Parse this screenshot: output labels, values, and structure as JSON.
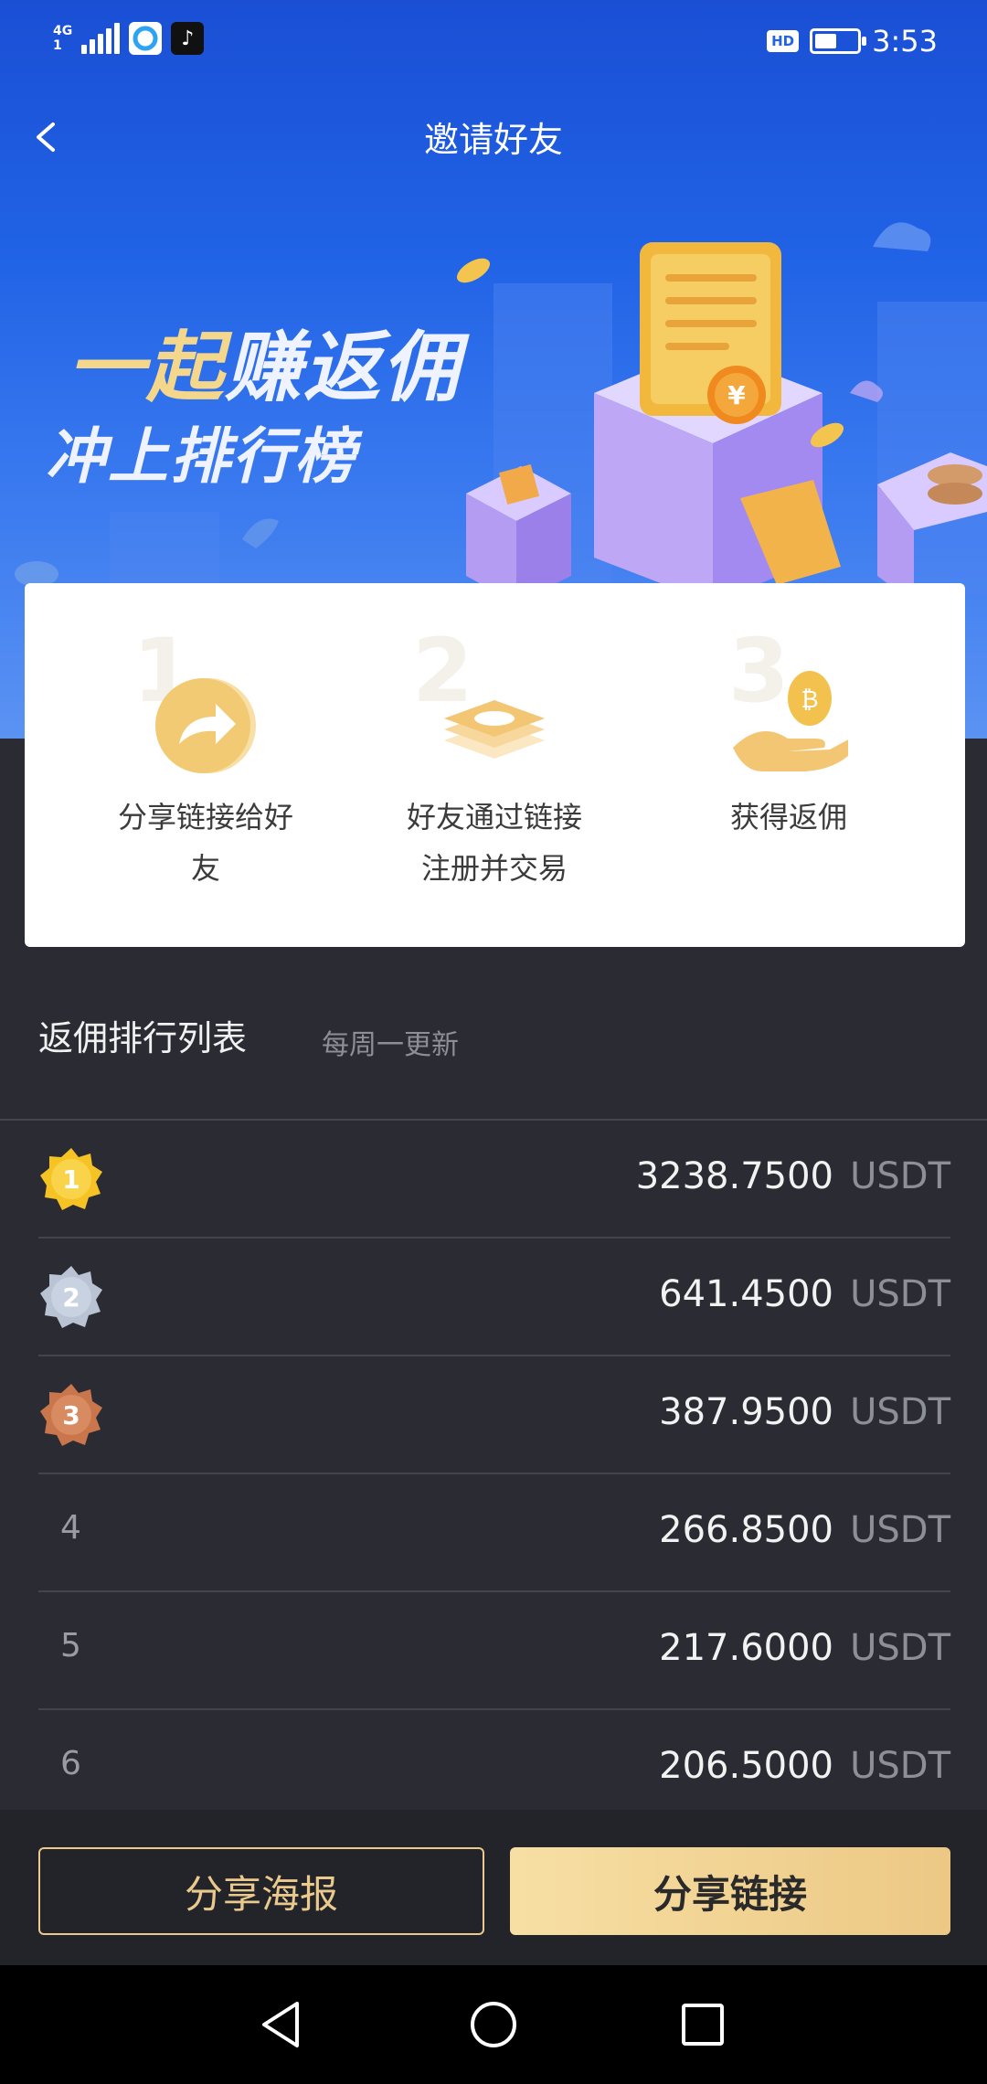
{
  "status_bar": {
    "network": "4G",
    "network_sub": "1",
    "hd": "HD",
    "time": "3:53",
    "battery_level": 0.45
  },
  "navbar": {
    "title": "邀请好友"
  },
  "banner": {
    "slogan_gold": "一起",
    "slogan_rest": "赚返佣",
    "slogan_line2": "冲上排行榜"
  },
  "steps": [
    {
      "num": "1",
      "label": "分享链接给好友",
      "icon": "share-arrow-icon"
    },
    {
      "num": "2",
      "label": "好友通过链接注册并交易",
      "icon": "layers-icon"
    },
    {
      "num": "3",
      "label": "获得返佣",
      "icon": "coin-hand-icon"
    }
  ],
  "ranking": {
    "title": "返佣排行列表",
    "subtitle": "每周一更新",
    "rows": [
      {
        "rank": "1",
        "value": "3238.7500",
        "unit": "USDT",
        "medal": "gold"
      },
      {
        "rank": "2",
        "value": "641.4500",
        "unit": "USDT",
        "medal": "silver"
      },
      {
        "rank": "3",
        "value": "387.9500",
        "unit": "USDT",
        "medal": "bronze"
      },
      {
        "rank": "4",
        "value": "266.8500",
        "unit": "USDT"
      },
      {
        "rank": "5",
        "value": "217.6000",
        "unit": "USDT"
      },
      {
        "rank": "6",
        "value": "206.5000",
        "unit": "USDT"
      }
    ]
  },
  "actions": {
    "poster": "分享海报",
    "link": "分享链接"
  },
  "colors": {
    "accent_gold": "#e9c98c",
    "hero_blue": "#2163e6",
    "bg_dark": "#2b2c33"
  }
}
